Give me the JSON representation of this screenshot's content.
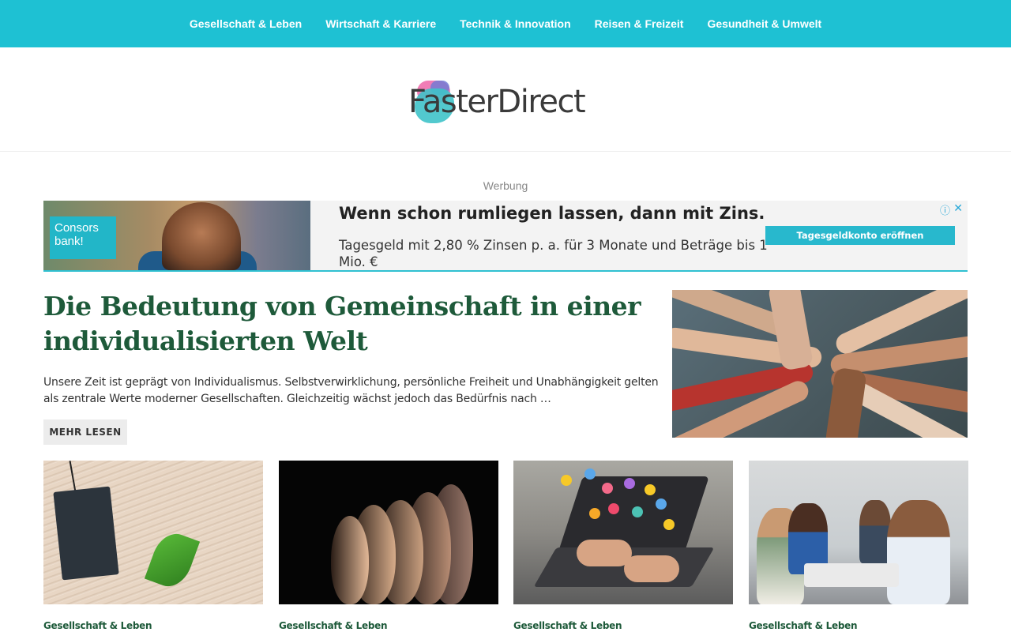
{
  "nav": {
    "items": [
      "Gesellschaft & Leben",
      "Wirtschaft & Karriere",
      "Technik & Innovation",
      "Reisen & Freizeit",
      "Gesundheit & Umwelt"
    ]
  },
  "logo": {
    "text": "FasterDirect"
  },
  "ad": {
    "label": "Werbung",
    "brand": "Consors bank!",
    "headline": "Wenn schon rumliegen lassen, dann mit Zins.",
    "subline": "Tagesgeld mit 2,80 % Zinsen p. a. für 3 Monate und Beträge bis 1 Mio. €",
    "cta": "Tagesgeldkonto eröffnen",
    "info_icon": "info-icon",
    "close_icon": "close-icon"
  },
  "featured": {
    "title": "Die Bedeutung von Gemeinschaft in einer individualisierten Welt",
    "excerpt": "Unsere Zeit ist geprägt von Individualismus. Selbstverwirklichung, persönliche Freiheit und Unabhängigkeit gelten als zentrale Werte moderner Gesellschaften. Gleichzeitig wächst jedoch das Bedürfnis nach …",
    "more_label": "MEHR LESEN"
  },
  "cards": [
    {
      "category": "Gesellschaft & Leben"
    },
    {
      "category": "Gesellschaft & Leben"
    },
    {
      "category": "Gesellschaft & Leben"
    },
    {
      "category": "Gesellschaft & Leben"
    }
  ],
  "colors": {
    "nav_bg": "#1ec1d3",
    "title_green": "#1e5a3a",
    "ad_accent": "#28b8cd"
  }
}
